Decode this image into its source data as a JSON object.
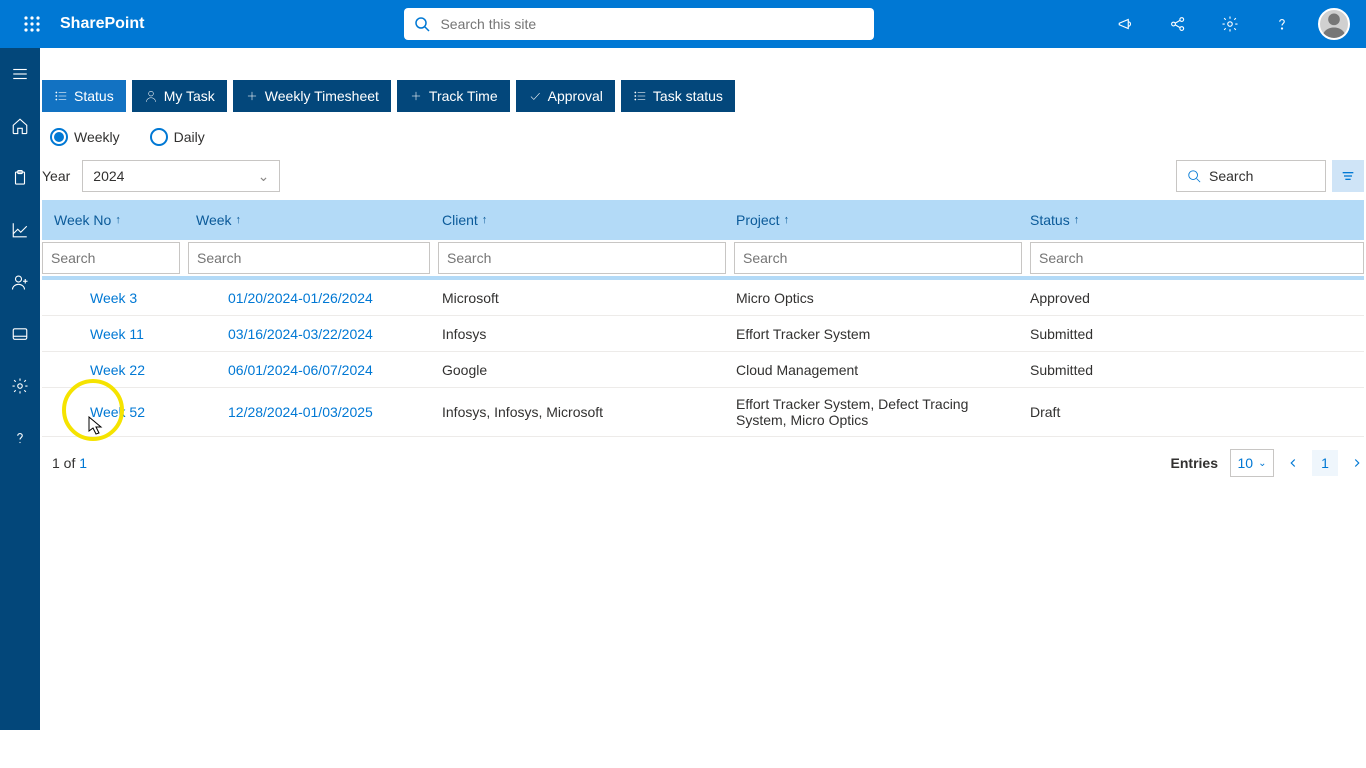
{
  "header": {
    "brand": "SharePoint",
    "search_placeholder": "Search this site"
  },
  "tabs": [
    {
      "id": "status",
      "label": "Status",
      "active": true,
      "icon": "list"
    },
    {
      "id": "mytask",
      "label": "My Task",
      "active": false,
      "icon": "person"
    },
    {
      "id": "weekly",
      "label": "Weekly Timesheet",
      "active": false,
      "icon": "plus"
    },
    {
      "id": "track",
      "label": "Track Time",
      "active": false,
      "icon": "plus"
    },
    {
      "id": "approval",
      "label": "Approval",
      "active": false,
      "icon": "check"
    },
    {
      "id": "taskstatus",
      "label": "Task status",
      "active": false,
      "icon": "list"
    }
  ],
  "view": {
    "weekly_label": "Weekly",
    "daily_label": "Daily",
    "selected": "weekly"
  },
  "year": {
    "label": "Year",
    "value": "2024"
  },
  "table_search": {
    "placeholder": "Search"
  },
  "columns": {
    "weekno": "Week No",
    "week": "Week",
    "client": "Client",
    "project": "Project",
    "status": "Status",
    "filter_placeholder": "Search"
  },
  "rows": [
    {
      "weekno": "Week 3",
      "week": "01/20/2024-01/26/2024",
      "client": "Microsoft",
      "project": "Micro Optics",
      "status": "Approved"
    },
    {
      "weekno": "Week 11",
      "week": "03/16/2024-03/22/2024",
      "client": "Infosys",
      "project": "Effort Tracker System",
      "status": "Submitted"
    },
    {
      "weekno": "Week 22",
      "week": "06/01/2024-06/07/2024",
      "client": "Google",
      "project": "Cloud Management",
      "status": "Submitted"
    },
    {
      "weekno": "Week 52",
      "week": "12/28/2024-01/03/2025",
      "client": "Infosys, Infosys, Microsoft",
      "project": "Effort Tracker System, Defect Tracing System, Micro Optics",
      "status": "Draft"
    }
  ],
  "pagination": {
    "info_prefix": "1 of ",
    "info_total": "1",
    "entries_label": "Entries",
    "entries_value": "10",
    "current_page": "1"
  }
}
